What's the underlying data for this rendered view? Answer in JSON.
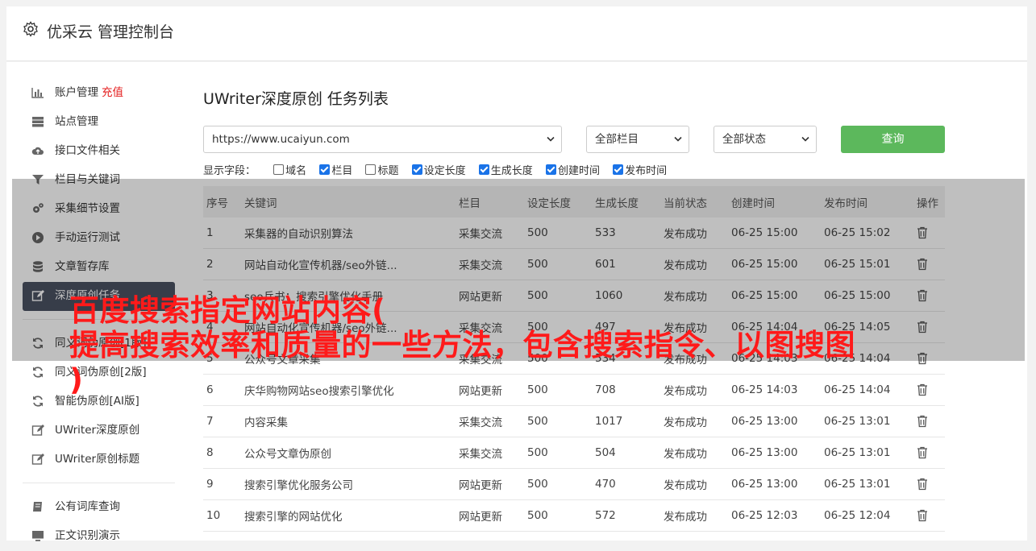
{
  "header": {
    "title": "优采云 管理控制台"
  },
  "sidebar": {
    "items": [
      {
        "label": "账户管理",
        "extra": "充值",
        "icon": "bar-chart-icon"
      },
      {
        "label": "站点管理",
        "icon": "server-icon"
      },
      {
        "label": "接口文件相关",
        "icon": "cloud-upload-icon"
      },
      {
        "label": "栏目与关键词",
        "icon": "filter-icon"
      },
      {
        "label": "采集细节设置",
        "icon": "gears-icon"
      },
      {
        "label": "手动运行测试",
        "icon": "play-icon"
      },
      {
        "label": "文章暂存库",
        "icon": "database-icon"
      },
      {
        "label": "深度原创任务",
        "icon": "edit-icon",
        "active": true
      },
      {
        "label": "同义词伪原创[1版]",
        "icon": "refresh-icon"
      },
      {
        "label": "同义词伪原创[2版]",
        "icon": "refresh-icon"
      },
      {
        "label": "智能伪原创[AI版]",
        "icon": "refresh-icon"
      },
      {
        "label": "UWriter深度原创",
        "icon": "edit-icon"
      },
      {
        "label": "UWriter原创标题",
        "icon": "edit-icon"
      }
    ],
    "items2": [
      {
        "label": "公有词库查询",
        "icon": "book-icon"
      },
      {
        "label": "正文识别演示",
        "icon": "monitor-icon"
      }
    ]
  },
  "main": {
    "title": "UWriter深度原创 任务列表",
    "site_select": "https://www.ucaiyun.com",
    "column_select": "全部栏目",
    "status_select": "全部状态",
    "query_label": "查询",
    "fields_label": "显示字段：",
    "fields": [
      {
        "label": "域名",
        "checked": false
      },
      {
        "label": "栏目",
        "checked": true
      },
      {
        "label": "标题",
        "checked": false
      },
      {
        "label": "设定长度",
        "checked": true
      },
      {
        "label": "生成长度",
        "checked": true
      },
      {
        "label": "创建时间",
        "checked": true
      },
      {
        "label": "发布时间",
        "checked": true
      }
    ],
    "columns": [
      "序号",
      "关键词",
      "栏目",
      "设定长度",
      "生成长度",
      "当前状态",
      "创建时间",
      "发布时间",
      "操作"
    ],
    "rows": [
      {
        "no": "1",
        "kw": "采集器的自动识别算法",
        "col": "采集交流",
        "set": "500",
        "gen": "533",
        "status": "发布成功",
        "created": "06-25 15:00",
        "published": "06-25 15:02"
      },
      {
        "no": "2",
        "kw": "网站自动化宣传机器/seo外链...",
        "col": "采集交流",
        "set": "500",
        "gen": "601",
        "status": "发布成功",
        "created": "06-25 15:00",
        "published": "06-25 15:01"
      },
      {
        "no": "3",
        "kw": "seo兵书：搜索引擎优化手册",
        "col": "网站更新",
        "set": "500",
        "gen": "1060",
        "status": "发布成功",
        "created": "06-25 15:00",
        "published": "06-25 15:00"
      },
      {
        "no": "4",
        "kw": "网站自动化宣传机器/seo外链...",
        "col": "采集交流",
        "set": "500",
        "gen": "497",
        "status": "发布成功",
        "created": "06-25 14:04",
        "published": "06-25 14:05"
      },
      {
        "no": "5",
        "kw": "公众号文章采集",
        "col": "采集交流",
        "set": "500",
        "gen": "534",
        "status": "发布成功",
        "created": "06-25 14:03",
        "published": "06-25 14:04"
      },
      {
        "no": "6",
        "kw": "庆华购物网站seo搜索引擎优化",
        "col": "网站更新",
        "set": "500",
        "gen": "708",
        "status": "发布成功",
        "created": "06-25 14:03",
        "published": "06-25 14:04"
      },
      {
        "no": "7",
        "kw": "内容采集",
        "col": "采集交流",
        "set": "500",
        "gen": "1017",
        "status": "发布成功",
        "created": "06-25 13:00",
        "published": "06-25 13:01"
      },
      {
        "no": "8",
        "kw": "公众号文章伪原创",
        "col": "采集交流",
        "set": "500",
        "gen": "504",
        "status": "发布成功",
        "created": "06-25 13:00",
        "published": "06-25 13:01"
      },
      {
        "no": "9",
        "kw": "搜索引擎优化服务公司",
        "col": "网站更新",
        "set": "500",
        "gen": "470",
        "status": "发布成功",
        "created": "06-25 13:00",
        "published": "06-25 13:01"
      },
      {
        "no": "10",
        "kw": "搜索引擎的网站优化",
        "col": "网站更新",
        "set": "500",
        "gen": "572",
        "status": "发布成功",
        "created": "06-25 12:03",
        "published": "06-25 12:04"
      }
    ]
  },
  "overlay_text": {
    "line1": "百度搜索指定网站内容(",
    "line2": "提高搜索效率和质量的一些方法，包含搜索指令、以图搜图",
    "line3": ")"
  }
}
